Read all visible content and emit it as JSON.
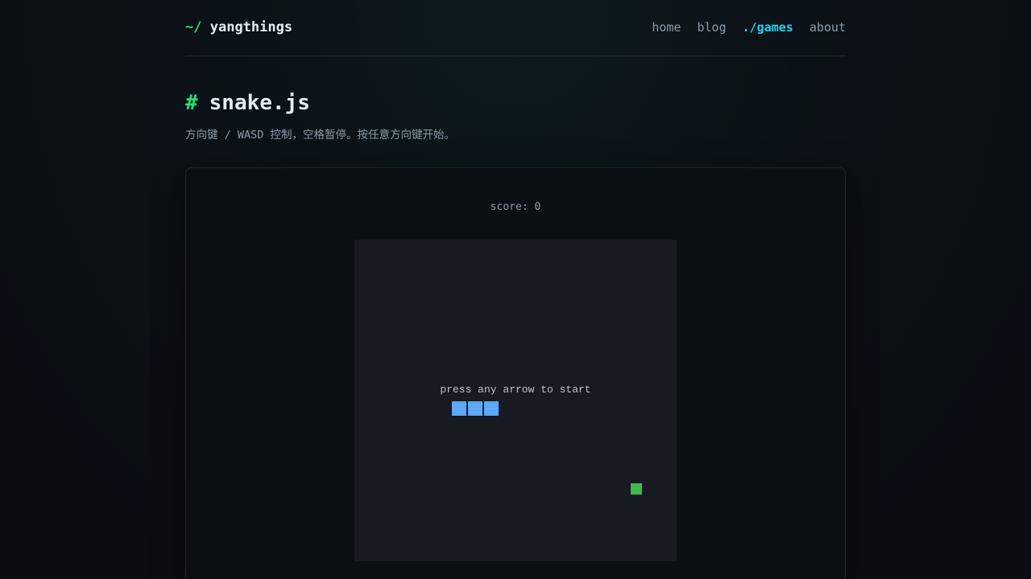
{
  "site": {
    "logo_prefix": "~/",
    "logo_name": "yangthings",
    "nav": [
      {
        "label": "home",
        "active": false
      },
      {
        "label": "blog",
        "active": false
      },
      {
        "label": "./games",
        "active": true
      },
      {
        "label": "about",
        "active": false
      }
    ]
  },
  "page": {
    "title_hash": "#",
    "title": "snake.js",
    "description": "方向键 / WASD 控制，空格暂停。按任意方向键开始。"
  },
  "game": {
    "score_text": "score: 0",
    "hint": "press any arrow to start",
    "grid_cells": 20,
    "snake": [
      [
        6,
        10
      ],
      [
        7,
        10
      ],
      [
        8,
        10
      ]
    ],
    "food": [
      17,
      15
    ],
    "colors": {
      "board": "#171a21",
      "snake": "#58a6ff",
      "food": "#3fb950",
      "accent_green": "#22e07a",
      "accent_cyan": "#22d3ee"
    }
  }
}
